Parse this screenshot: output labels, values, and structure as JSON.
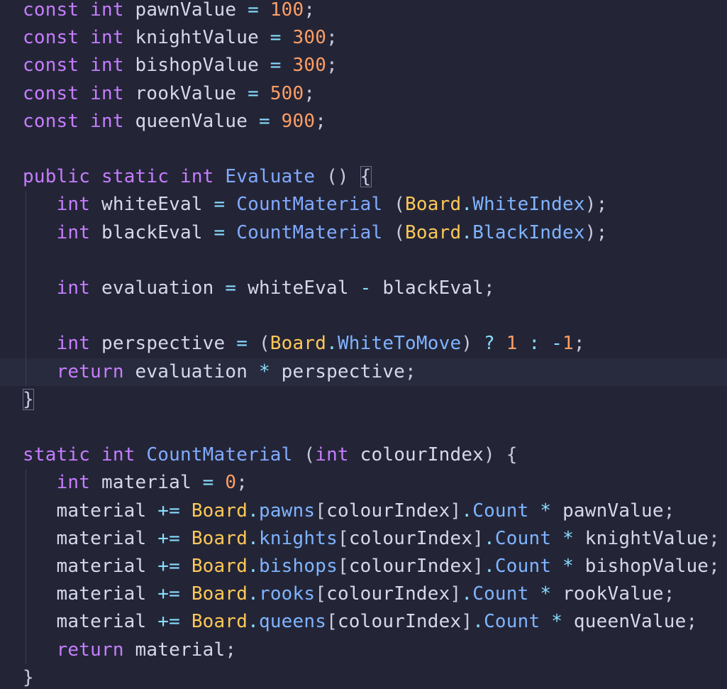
{
  "editor": {
    "theme": {
      "background": "#232537",
      "keyword": "#c77dff",
      "number": "#ff9e64",
      "function": "#82aaff",
      "class": "#ffc857",
      "property": "#7fb4ff",
      "operator": "#89ddff",
      "identifier": "#d5d8ea"
    },
    "lines": [
      [
        [
          "kw",
          "const"
        ],
        [
          "id",
          " "
        ],
        [
          "kw",
          "int"
        ],
        [
          "id",
          " pawnValue "
        ],
        [
          "op",
          "="
        ],
        [
          "id",
          " "
        ],
        [
          "num",
          "100"
        ],
        [
          "punc",
          ";"
        ]
      ],
      [
        [
          "kw",
          "const"
        ],
        [
          "id",
          " "
        ],
        [
          "kw",
          "int"
        ],
        [
          "id",
          " knightValue "
        ],
        [
          "op",
          "="
        ],
        [
          "id",
          " "
        ],
        [
          "num",
          "300"
        ],
        [
          "punc",
          ";"
        ]
      ],
      [
        [
          "kw",
          "const"
        ],
        [
          "id",
          " "
        ],
        [
          "kw",
          "int"
        ],
        [
          "id",
          " bishopValue "
        ],
        [
          "op",
          "="
        ],
        [
          "id",
          " "
        ],
        [
          "num",
          "300"
        ],
        [
          "punc",
          ";"
        ]
      ],
      [
        [
          "kw",
          "const"
        ],
        [
          "id",
          " "
        ],
        [
          "kw",
          "int"
        ],
        [
          "id",
          " rookValue "
        ],
        [
          "op",
          "="
        ],
        [
          "id",
          " "
        ],
        [
          "num",
          "500"
        ],
        [
          "punc",
          ";"
        ]
      ],
      [
        [
          "kw",
          "const"
        ],
        [
          "id",
          " "
        ],
        [
          "kw",
          "int"
        ],
        [
          "id",
          " queenValue "
        ],
        [
          "op",
          "="
        ],
        [
          "id",
          " "
        ],
        [
          "num",
          "900"
        ],
        [
          "punc",
          ";"
        ]
      ],
      [],
      [
        [
          "kw",
          "public"
        ],
        [
          "id",
          " "
        ],
        [
          "kw",
          "static"
        ],
        [
          "id",
          " "
        ],
        [
          "kw",
          "int"
        ],
        [
          "id",
          " "
        ],
        [
          "fn",
          "Evaluate"
        ],
        [
          "id",
          " "
        ],
        [
          "punc",
          "() "
        ],
        [
          "brace",
          "{"
        ]
      ],
      [
        [
          "id",
          "   "
        ],
        [
          "kw",
          "int"
        ],
        [
          "id",
          " whiteEval "
        ],
        [
          "op",
          "="
        ],
        [
          "id",
          " "
        ],
        [
          "fn",
          "CountMaterial"
        ],
        [
          "id",
          " "
        ],
        [
          "punc",
          "("
        ],
        [
          "cls",
          "Board"
        ],
        [
          "op",
          "."
        ],
        [
          "prop",
          "WhiteIndex"
        ],
        [
          "punc",
          ");"
        ]
      ],
      [
        [
          "id",
          "   "
        ],
        [
          "kw",
          "int"
        ],
        [
          "id",
          " blackEval "
        ],
        [
          "op",
          "="
        ],
        [
          "id",
          " "
        ],
        [
          "fn",
          "CountMaterial"
        ],
        [
          "id",
          " "
        ],
        [
          "punc",
          "("
        ],
        [
          "cls",
          "Board"
        ],
        [
          "op",
          "."
        ],
        [
          "prop",
          "BlackIndex"
        ],
        [
          "punc",
          ");"
        ]
      ],
      [
        [
          "id",
          "   "
        ]
      ],
      [
        [
          "id",
          "   "
        ],
        [
          "kw",
          "int"
        ],
        [
          "id",
          " evaluation "
        ],
        [
          "op",
          "="
        ],
        [
          "id",
          " whiteEval "
        ],
        [
          "op",
          "-"
        ],
        [
          "id",
          " blackEval"
        ],
        [
          "punc",
          ";"
        ]
      ],
      [
        [
          "id",
          "   "
        ]
      ],
      [
        [
          "id",
          "   "
        ],
        [
          "kw",
          "int"
        ],
        [
          "id",
          " perspective "
        ],
        [
          "op",
          "="
        ],
        [
          "id",
          " "
        ],
        [
          "punc",
          "("
        ],
        [
          "cls",
          "Board"
        ],
        [
          "op",
          "."
        ],
        [
          "prop",
          "WhiteToMove"
        ],
        [
          "punc",
          ")"
        ],
        [
          "id",
          " "
        ],
        [
          "op",
          "?"
        ],
        [
          "id",
          " "
        ],
        [
          "num",
          "1"
        ],
        [
          "id",
          " "
        ],
        [
          "op",
          ":"
        ],
        [
          "id",
          " "
        ],
        [
          "op",
          "-"
        ],
        [
          "num",
          "1"
        ],
        [
          "punc",
          ";"
        ]
      ],
      [
        [
          "id",
          "   "
        ],
        [
          "kw",
          "return"
        ],
        [
          "id",
          " evaluation "
        ],
        [
          "op",
          "*"
        ],
        [
          "id",
          " perspective"
        ],
        [
          "punc",
          ";"
        ]
      ],
      [
        [
          "brace",
          "}"
        ]
      ],
      [],
      [
        [
          "kw",
          "static"
        ],
        [
          "id",
          " "
        ],
        [
          "kw",
          "int"
        ],
        [
          "id",
          " "
        ],
        [
          "fn",
          "CountMaterial"
        ],
        [
          "id",
          " "
        ],
        [
          "punc",
          "("
        ],
        [
          "kw",
          "int"
        ],
        [
          "id",
          " colourIndex"
        ],
        [
          "punc",
          ")"
        ],
        [
          "id",
          " "
        ],
        [
          "punc",
          "{"
        ]
      ],
      [
        [
          "id",
          "   "
        ],
        [
          "kw",
          "int"
        ],
        [
          "id",
          " material "
        ],
        [
          "op",
          "="
        ],
        [
          "id",
          " "
        ],
        [
          "num",
          "0"
        ],
        [
          "punc",
          ";"
        ]
      ],
      [
        [
          "id",
          "   material "
        ],
        [
          "op",
          "+="
        ],
        [
          "id",
          " "
        ],
        [
          "cls",
          "Board"
        ],
        [
          "op",
          "."
        ],
        [
          "prop",
          "pawns"
        ],
        [
          "punc",
          "["
        ],
        [
          "id",
          "colourIndex"
        ],
        [
          "punc",
          "]"
        ],
        [
          "op",
          "."
        ],
        [
          "prop",
          "Count"
        ],
        [
          "id",
          " "
        ],
        [
          "op",
          "*"
        ],
        [
          "id",
          " pawnValue"
        ],
        [
          "punc",
          ";"
        ]
      ],
      [
        [
          "id",
          "   material "
        ],
        [
          "op",
          "+="
        ],
        [
          "id",
          " "
        ],
        [
          "cls",
          "Board"
        ],
        [
          "op",
          "."
        ],
        [
          "prop",
          "knights"
        ],
        [
          "punc",
          "["
        ],
        [
          "id",
          "colourIndex"
        ],
        [
          "punc",
          "]"
        ],
        [
          "op",
          "."
        ],
        [
          "prop",
          "Count"
        ],
        [
          "id",
          " "
        ],
        [
          "op",
          "*"
        ],
        [
          "id",
          " knightValue"
        ],
        [
          "punc",
          ";"
        ]
      ],
      [
        [
          "id",
          "   material "
        ],
        [
          "op",
          "+="
        ],
        [
          "id",
          " "
        ],
        [
          "cls",
          "Board"
        ],
        [
          "op",
          "."
        ],
        [
          "prop",
          "bishops"
        ],
        [
          "punc",
          "["
        ],
        [
          "id",
          "colourIndex"
        ],
        [
          "punc",
          "]"
        ],
        [
          "op",
          "."
        ],
        [
          "prop",
          "Count"
        ],
        [
          "id",
          " "
        ],
        [
          "op",
          "*"
        ],
        [
          "id",
          " bishopValue"
        ],
        [
          "punc",
          ";"
        ]
      ],
      [
        [
          "id",
          "   material "
        ],
        [
          "op",
          "+="
        ],
        [
          "id",
          " "
        ],
        [
          "cls",
          "Board"
        ],
        [
          "op",
          "."
        ],
        [
          "prop",
          "rooks"
        ],
        [
          "punc",
          "["
        ],
        [
          "id",
          "colourIndex"
        ],
        [
          "punc",
          "]"
        ],
        [
          "op",
          "."
        ],
        [
          "prop",
          "Count"
        ],
        [
          "id",
          " "
        ],
        [
          "op",
          "*"
        ],
        [
          "id",
          " rookValue"
        ],
        [
          "punc",
          ";"
        ]
      ],
      [
        [
          "id",
          "   material "
        ],
        [
          "op",
          "+="
        ],
        [
          "id",
          " "
        ],
        [
          "cls",
          "Board"
        ],
        [
          "op",
          "."
        ],
        [
          "prop",
          "queens"
        ],
        [
          "punc",
          "["
        ],
        [
          "id",
          "colourIndex"
        ],
        [
          "punc",
          "]"
        ],
        [
          "op",
          "."
        ],
        [
          "prop",
          "Count"
        ],
        [
          "id",
          " "
        ],
        [
          "op",
          "*"
        ],
        [
          "id",
          " queenValue"
        ],
        [
          "punc",
          ";"
        ]
      ],
      [
        [
          "id",
          "   "
        ],
        [
          "kw",
          "return"
        ],
        [
          "id",
          " material"
        ],
        [
          "punc",
          ";"
        ]
      ],
      [
        [
          "punc",
          "}"
        ]
      ]
    ],
    "current_line": 13,
    "indented_lines": [
      7,
      8,
      9,
      10,
      11,
      12,
      13,
      17,
      18,
      19,
      20,
      21,
      22,
      23
    ]
  }
}
